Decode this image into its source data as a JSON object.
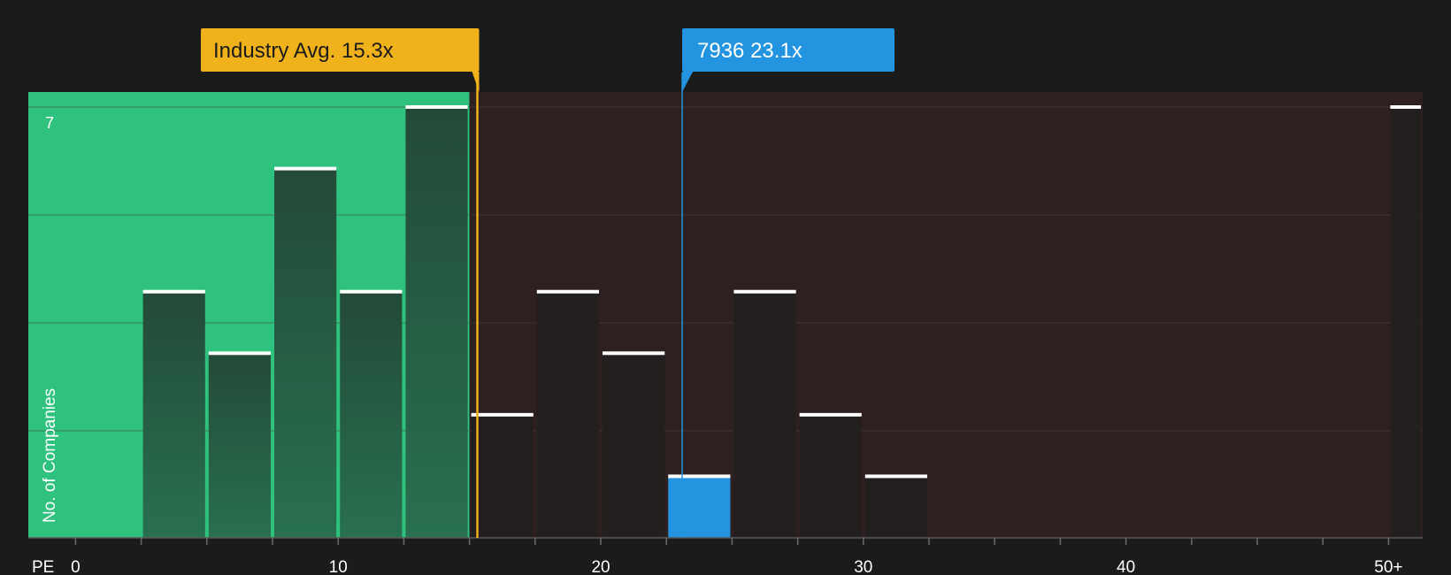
{
  "chart_data": {
    "type": "bar",
    "xlabel": "PE",
    "ylabel": "No. of Companies",
    "x_tick_labels": [
      "0",
      "10",
      "20",
      "30",
      "40",
      "50+"
    ],
    "y_tick_labels": [
      "7"
    ],
    "ylim": [
      0,
      7
    ],
    "xlim": [
      -1.8,
      51.3
    ],
    "bin_width": 2.5,
    "bars": [
      {
        "x_start": 2.5,
        "x_end": 5.0,
        "value": 4
      },
      {
        "x_start": 5.0,
        "x_end": 7.5,
        "value": 3
      },
      {
        "x_start": 7.5,
        "x_end": 10.0,
        "value": 6
      },
      {
        "x_start": 10.0,
        "x_end": 12.5,
        "value": 4
      },
      {
        "x_start": 12.5,
        "x_end": 15.0,
        "value": 7
      },
      {
        "x_start": 15.0,
        "x_end": 17.5,
        "value": 2
      },
      {
        "x_start": 17.5,
        "x_end": 20.0,
        "value": 4
      },
      {
        "x_start": 20.0,
        "x_end": 22.5,
        "value": 3
      },
      {
        "x_start": 22.5,
        "x_end": 25.0,
        "value": 1,
        "highlight": true
      },
      {
        "x_start": 25.0,
        "x_end": 27.5,
        "value": 4
      },
      {
        "x_start": 27.5,
        "x_end": 30.0,
        "value": 2
      },
      {
        "x_start": 30.0,
        "x_end": 32.5,
        "value": 1
      },
      {
        "x_start": 50.0,
        "x_end": 51.3,
        "value": 7
      }
    ],
    "grid": true,
    "annotations": {
      "industry": {
        "label": "Industry Avg. 15.3x",
        "value": 15.3,
        "color": "#f0b21a"
      },
      "company": {
        "label": "7936 23.1x",
        "value": 23.1,
        "color": "#2394e0"
      }
    },
    "colors": {
      "background": "#1b1b1b",
      "undervalued_region": "#2ec27e",
      "overvalued_region": "#2e1f20",
      "bar_in_green": "#234a38",
      "bar_in_red": "#241f1f",
      "highlight_bar": "#2394e0",
      "bar_cap": "#ffffff",
      "gridline": "#4a4444",
      "axis_text": "#ffffff"
    }
  }
}
